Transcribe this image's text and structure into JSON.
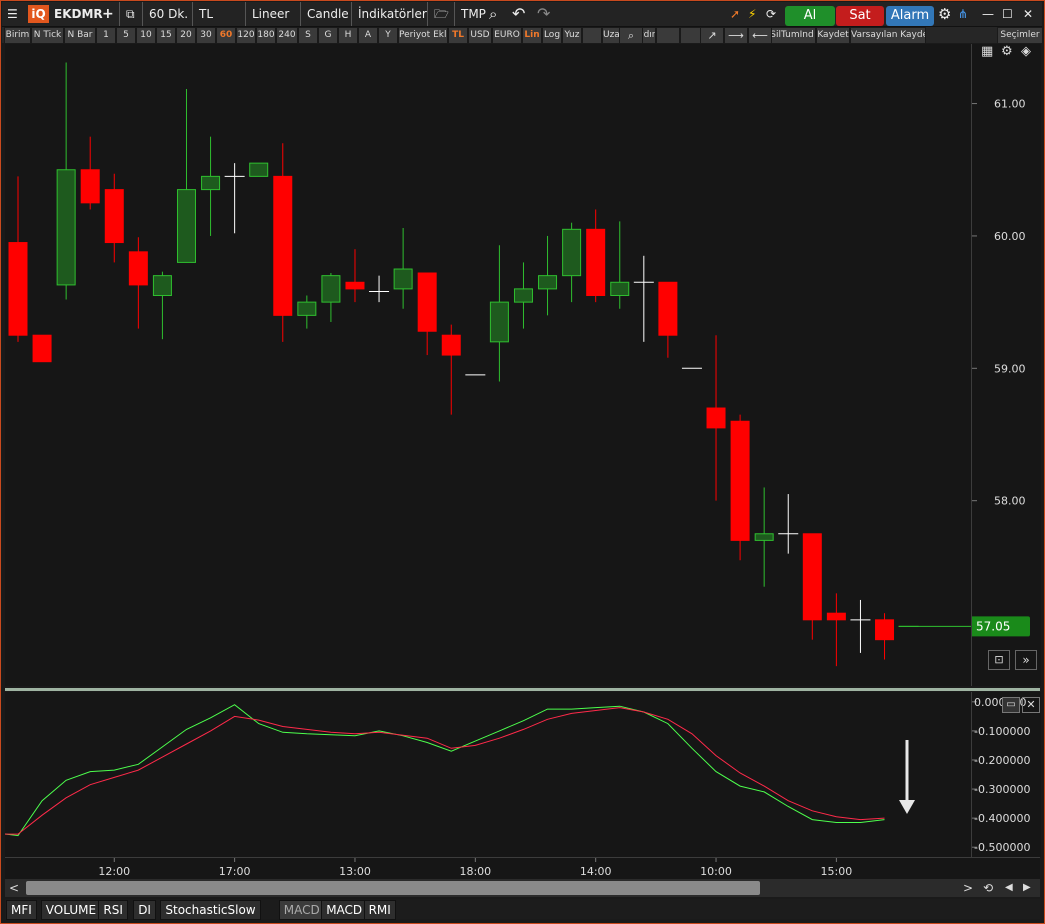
{
  "topbar": {
    "symbol": "EKDMR",
    "period": "60 Dk.",
    "currency": "TL",
    "scale": "Lineer",
    "chart_type": "Candle",
    "indicators": "İndikatörler",
    "tmp": "TMP",
    "buy": "Al",
    "sell": "Sat",
    "alarm": "Alarm"
  },
  "toolbar2": [
    "Birim",
    "N Tick",
    "N Bar",
    "1",
    "5",
    "10",
    "15",
    "20",
    "30",
    "60",
    "120",
    "180",
    "240",
    "S",
    "G",
    "H",
    "A",
    "Y",
    "Periyot Ekle",
    "TL",
    "USD",
    "EURO",
    "Lin",
    "Log",
    "Yuz",
    "",
    "Uzak",
    "Kaydır",
    "",
    "",
    "",
    "SilTrend",
    "SilTumInd",
    "Kaydet",
    "Varsayılan Kaydet",
    "Seçimler"
  ],
  "toolbar2_active": [
    "60",
    "TL",
    "Lin"
  ],
  "price_axis": {
    "ticks": [
      "61.00",
      "60.00",
      "59.00",
      "58.00"
    ],
    "last_price": "57.05"
  },
  "sub_axis": {
    "ticks": [
      "0.000000",
      "-0.100000",
      "-0.200000",
      "-0.300000",
      "-0.400000",
      "-0.500000"
    ]
  },
  "x_axis": {
    "ticks": [
      "12:00",
      "17:00",
      "13:00",
      "18:00",
      "14:00",
      "10:00",
      "15:00"
    ]
  },
  "tabs": [
    "MFI",
    "VOLUME",
    "RSI",
    "DI",
    "StochasticSlow",
    "MACD",
    "MACD",
    "RMI"
  ],
  "selected_tab": 5,
  "colors": {
    "up": "#1e5a1e",
    "up_edge": "#2fbf2f",
    "down": "#ff0000",
    "doji": "#ffffff",
    "macd": "#4dff4d",
    "signal": "#ff2a4a",
    "last_price_bg": "#1a8a1a"
  },
  "chart_data": [
    {
      "type": "candlestick",
      "ylim": [
        56.6,
        61.45
      ],
      "x_tick_indices": [
        4,
        9,
        14,
        19,
        24,
        29,
        34
      ],
      "x_tick_labels": [
        "12:00",
        "17:00",
        "13:00",
        "18:00",
        "14:00",
        "10:00",
        "15:00"
      ],
      "candles": [
        {
          "o": 59.95,
          "h": 60.45,
          "l": 59.2,
          "c": 59.25
        },
        {
          "o": 59.25,
          "h": 59.25,
          "l": 59.05,
          "c": 59.05
        },
        {
          "o": 59.63,
          "h": 61.31,
          "l": 59.52,
          "c": 60.5
        },
        {
          "o": 60.5,
          "h": 60.75,
          "l": 60.2,
          "c": 60.25
        },
        {
          "o": 60.35,
          "h": 60.47,
          "l": 59.8,
          "c": 59.95
        },
        {
          "o": 59.88,
          "h": 59.99,
          "l": 59.3,
          "c": 59.63
        },
        {
          "o": 59.55,
          "h": 59.73,
          "l": 59.22,
          "c": 59.7
        },
        {
          "o": 59.8,
          "h": 61.11,
          "l": 59.8,
          "c": 60.35
        },
        {
          "o": 60.35,
          "h": 60.75,
          "l": 60.0,
          "c": 60.45
        },
        {
          "o": 60.45,
          "h": 60.55,
          "l": 60.02,
          "c": 60.45
        },
        {
          "o": 60.45,
          "h": 60.55,
          "l": 60.45,
          "c": 60.55
        },
        {
          "o": 60.45,
          "h": 60.7,
          "l": 59.2,
          "c": 59.4
        },
        {
          "o": 59.4,
          "h": 59.55,
          "l": 59.3,
          "c": 59.5
        },
        {
          "o": 59.5,
          "h": 59.72,
          "l": 59.35,
          "c": 59.7
        },
        {
          "o": 59.65,
          "h": 59.9,
          "l": 59.5,
          "c": 59.6
        },
        {
          "o": 59.58,
          "h": 59.7,
          "l": 59.5,
          "c": 59.58
        },
        {
          "o": 59.6,
          "h": 60.06,
          "l": 59.45,
          "c": 59.75
        },
        {
          "o": 59.72,
          "h": 59.72,
          "l": 59.1,
          "c": 59.28
        },
        {
          "o": 59.25,
          "h": 59.33,
          "l": 58.65,
          "c": 59.1
        },
        {
          "o": 58.95,
          "h": 58.95,
          "l": 58.95,
          "c": 58.95
        },
        {
          "o": 59.2,
          "h": 59.93,
          "l": 58.9,
          "c": 59.5
        },
        {
          "o": 59.5,
          "h": 59.8,
          "l": 59.3,
          "c": 59.6
        },
        {
          "o": 59.6,
          "h": 60.0,
          "l": 59.4,
          "c": 59.7
        },
        {
          "o": 59.7,
          "h": 60.1,
          "l": 59.5,
          "c": 60.05
        },
        {
          "o": 60.05,
          "h": 60.2,
          "l": 59.5,
          "c": 59.55
        },
        {
          "o": 59.55,
          "h": 60.11,
          "l": 59.45,
          "c": 59.65
        },
        {
          "o": 59.65,
          "h": 59.85,
          "l": 59.2,
          "c": 59.65
        },
        {
          "o": 59.65,
          "h": 59.65,
          "l": 59.08,
          "c": 59.25
        },
        {
          "o": 59.0,
          "h": 59.0,
          "l": 59.0,
          "c": 59.0
        },
        {
          "o": 58.7,
          "h": 59.25,
          "l": 58.0,
          "c": 58.55
        },
        {
          "o": 58.6,
          "h": 58.65,
          "l": 57.55,
          "c": 57.7
        },
        {
          "o": 57.7,
          "h": 58.1,
          "l": 57.35,
          "c": 57.75
        },
        {
          "o": 57.75,
          "h": 58.05,
          "l": 57.6,
          "c": 57.75
        },
        {
          "o": 57.75,
          "h": 57.75,
          "l": 56.95,
          "c": 57.1
        },
        {
          "o": 57.15,
          "h": 57.3,
          "l": 56.75,
          "c": 57.1
        },
        {
          "o": 57.1,
          "h": 57.25,
          "l": 56.85,
          "c": 57.1
        },
        {
          "o": 57.1,
          "h": 57.15,
          "l": 56.8,
          "c": 56.95
        },
        {
          "o": 57.05,
          "h": 57.05,
          "l": 57.05,
          "c": 57.05
        }
      ],
      "last_price": 57.05
    },
    {
      "type": "line",
      "ylim": [
        -0.52,
        0.02
      ],
      "x": [
        -1,
        0,
        1,
        2,
        3,
        4,
        5,
        6,
        7,
        8,
        9,
        10,
        11,
        12,
        13,
        14,
        15,
        16,
        17,
        18,
        19,
        20,
        21,
        22,
        23,
        24,
        25,
        26,
        27,
        28,
        29,
        30,
        31,
        32,
        33,
        34,
        35,
        36
      ],
      "series": [
        {
          "color": "#4dff4d",
          "values": [
            -0.45,
            -0.46,
            -0.34,
            -0.27,
            -0.24,
            -0.235,
            -0.215,
            -0.155,
            -0.095,
            -0.055,
            -0.01,
            -0.075,
            -0.105,
            -0.11,
            -0.113,
            -0.117,
            -0.1,
            -0.117,
            -0.14,
            -0.17,
            -0.135,
            -0.1,
            -0.065,
            -0.025,
            -0.025,
            -0.02,
            -0.015,
            -0.035,
            -0.075,
            -0.16,
            -0.24,
            -0.29,
            -0.31,
            -0.36,
            -0.405,
            -0.415,
            -0.415,
            -0.405
          ]
        },
        {
          "color": "#ff2a4a",
          "values": [
            -0.455,
            -0.455,
            -0.39,
            -0.33,
            -0.285,
            -0.26,
            -0.235,
            -0.19,
            -0.145,
            -0.1,
            -0.05,
            -0.063,
            -0.085,
            -0.095,
            -0.105,
            -0.11,
            -0.105,
            -0.115,
            -0.125,
            -0.16,
            -0.15,
            -0.125,
            -0.095,
            -0.06,
            -0.04,
            -0.03,
            -0.02,
            -0.035,
            -0.06,
            -0.11,
            -0.185,
            -0.245,
            -0.29,
            -0.34,
            -0.375,
            -0.395,
            -0.405,
            -0.4
          ]
        }
      ]
    }
  ]
}
